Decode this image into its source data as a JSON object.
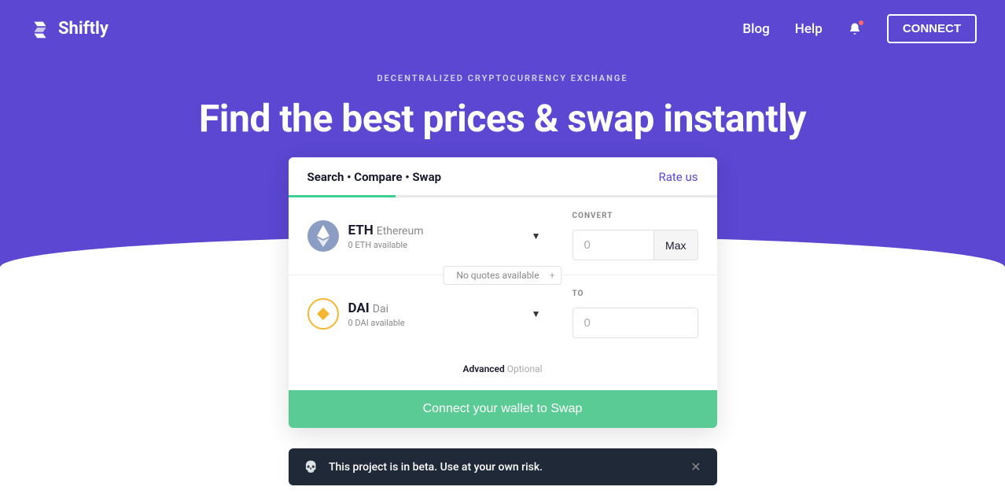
{
  "header": {
    "brand": "Shiftly",
    "nav": {
      "blog": "Blog",
      "help": "Help"
    },
    "connect": "CONNECT"
  },
  "hero": {
    "eyebrow": "DECENTRALIZED CRYPTOCURRENCY EXCHANGE",
    "headline": "Find the best prices & swap instantly"
  },
  "card": {
    "title": "Search • Compare • Swap",
    "rate_us": "Rate us",
    "progress_percent": 25,
    "from": {
      "symbol": "ETH",
      "name": "Ethereum",
      "available": "0 ETH available",
      "label": "CONVERT",
      "placeholder": "0",
      "max_label": "Max"
    },
    "quote_text": "No quotes available",
    "to": {
      "symbol": "DAI",
      "name": "Dai",
      "available": "0 DAI available",
      "label": "TO",
      "placeholder": "0"
    },
    "advanced": "Advanced",
    "advanced_optional": "Optional",
    "cta": "Connect your wallet to Swap"
  },
  "banner": {
    "text": "This project is in beta. Use at your own risk."
  },
  "colors": {
    "primary": "#5b47d1",
    "accent": "#3ece8e"
  }
}
